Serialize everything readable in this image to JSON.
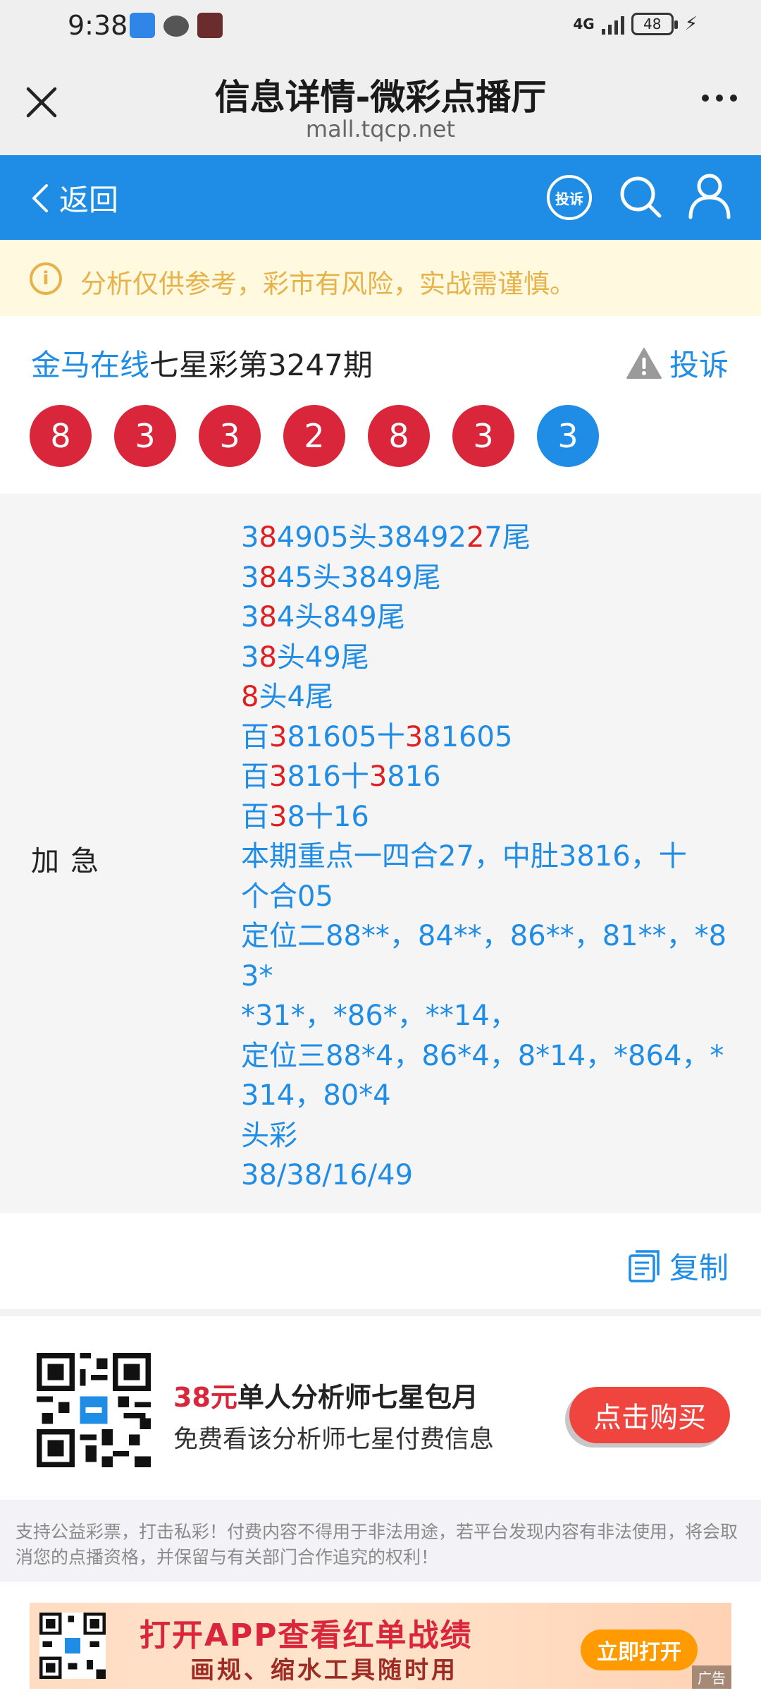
{
  "status_bar": {
    "time": "9:38",
    "network": "4G",
    "battery": "48"
  },
  "browser": {
    "title": "信息详情-微彩点播厅",
    "url": "mall.tqcp.net"
  },
  "nav": {
    "back_label": "返回",
    "complain_badge": "投诉"
  },
  "warning": {
    "text": "分析仅供参考，彩市有风险，实战需谨慎。"
  },
  "issue": {
    "source": "金马在线",
    "name": "七星彩第3247期",
    "complain_label": "投诉",
    "balls": [
      {
        "value": "8",
        "color": "red"
      },
      {
        "value": "3",
        "color": "red"
      },
      {
        "value": "3",
        "color": "red"
      },
      {
        "value": "2",
        "color": "red"
      },
      {
        "value": "8",
        "color": "red"
      },
      {
        "value": "3",
        "color": "red"
      },
      {
        "value": "3",
        "color": "blue"
      }
    ]
  },
  "analysis": {
    "label": "加急",
    "lines": [
      {
        "segments": [
          {
            "t": "3",
            "hl": false
          },
          {
            "t": "8",
            "hl": true
          },
          {
            "t": "4905头38492",
            "hl": false
          },
          {
            "t": "2",
            "hl": true
          },
          {
            "t": "7尾",
            "hl": false
          }
        ]
      },
      {
        "segments": [
          {
            "t": "3",
            "hl": false
          },
          {
            "t": "8",
            "hl": true
          },
          {
            "t": "45头3849尾",
            "hl": false
          }
        ]
      },
      {
        "segments": [
          {
            "t": "3",
            "hl": false
          },
          {
            "t": "8",
            "hl": true
          },
          {
            "t": "4头849尾",
            "hl": false
          }
        ]
      },
      {
        "segments": [
          {
            "t": "3",
            "hl": false
          },
          {
            "t": "8",
            "hl": true
          },
          {
            "t": "头49尾",
            "hl": false
          }
        ]
      },
      {
        "segments": [
          {
            "t": "8",
            "hl": true
          },
          {
            "t": "头4尾",
            "hl": false
          }
        ]
      },
      {
        "segments": [
          {
            "t": "百",
            "hl": false
          },
          {
            "t": "3",
            "hl": true
          },
          {
            "t": "81605十",
            "hl": false
          },
          {
            "t": "3",
            "hl": true
          },
          {
            "t": "81605",
            "hl": false
          }
        ]
      },
      {
        "segments": [
          {
            "t": "百",
            "hl": false
          },
          {
            "t": "3",
            "hl": true
          },
          {
            "t": "816十",
            "hl": false
          },
          {
            "t": "3",
            "hl": true
          },
          {
            "t": "816",
            "hl": false
          }
        ]
      },
      {
        "segments": [
          {
            "t": "百",
            "hl": false
          },
          {
            "t": "3",
            "hl": true
          },
          {
            "t": "8十16",
            "hl": false
          }
        ]
      },
      {
        "segments": [
          {
            "t": "本期重点一四合27，中肚3816，十",
            "hl": false
          }
        ]
      },
      {
        "segments": [
          {
            "t": "个合05",
            "hl": false
          }
        ]
      },
      {
        "segments": [
          {
            "t": "定位二88**，84**，86**，81**，*8",
            "hl": false
          }
        ]
      },
      {
        "segments": [
          {
            "t": "3*",
            "hl": false
          }
        ]
      },
      {
        "segments": [
          {
            "t": "*31*，*86*，**14，",
            "hl": false
          }
        ]
      },
      {
        "segments": [
          {
            "t": "定位三88*4，86*4，8*14，*864，*",
            "hl": false
          }
        ]
      },
      {
        "segments": [
          {
            "t": "314，80*4",
            "hl": false
          }
        ]
      },
      {
        "segments": [
          {
            "t": "头彩",
            "hl": false
          }
        ]
      },
      {
        "segments": [
          {
            "t": "38/38/16/49",
            "hl": false
          }
        ]
      }
    ]
  },
  "copy": {
    "label": "复制"
  },
  "purchase": {
    "price": "38元",
    "title": "单人分析师七星包月",
    "subtitle": "免费看该分析师七星付费信息",
    "button": "点击购买"
  },
  "disclaimer": {
    "text": "支持公益彩票，打击私彩！付费内容不得用于非法用途，若平台发现内容有非法使用，将会取消您的点播资格，并保留与有关部门合作追究的权利！"
  },
  "ad": {
    "headline": "打开APP查看红单战绩",
    "sub": "画规、缩水工具随时用",
    "button": "立即打开",
    "tag": "广告"
  },
  "colors": {
    "brand_blue": "#1f8ce6",
    "ball_red": "#d9263a",
    "warning": "#e8b24a",
    "buy_red": "#f0453f"
  }
}
